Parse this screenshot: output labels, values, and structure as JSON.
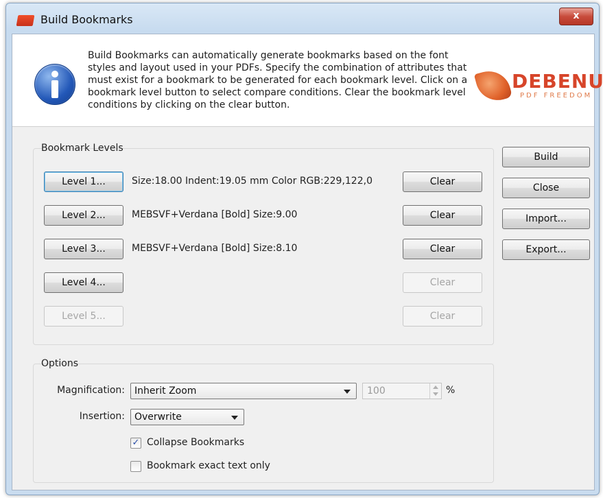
{
  "window": {
    "title": "Build Bookmarks",
    "close_glyph": "x"
  },
  "info": {
    "text": "Build Bookmarks can automatically generate bookmarks based on the font styles and layout used in your PDFs. Specify the combination of attributes that must exist for a bookmark to be generated for each bookmark level. Click on a bookmark level button to select compare conditions. Clear the bookmark level conditions by clicking on the clear button.",
    "logo_main": "DEBENU",
    "logo_sub": "PDF FREEDOM"
  },
  "bookmark_levels": {
    "label": "Bookmark Levels",
    "levels": [
      {
        "button": "Level 1...",
        "description": "Size:18.00 Indent:19.05 mm Color RGB:229,122,0",
        "clear": "Clear"
      },
      {
        "button": "Level 2...",
        "description": "MEBSVF+Verdana [Bold] Size:9.00",
        "clear": "Clear"
      },
      {
        "button": "Level 3...",
        "description": "MEBSVF+Verdana [Bold] Size:8.10",
        "clear": "Clear"
      },
      {
        "button": "Level 4...",
        "description": "",
        "clear": "Clear"
      },
      {
        "button": "Level 5...",
        "description": "",
        "clear": "Clear"
      }
    ]
  },
  "actions": {
    "build": "Build",
    "close": "Close",
    "import": "Import...",
    "export": "Export..."
  },
  "options": {
    "label": "Options",
    "magnification_label": "Magnification:",
    "magnification_value": "Inherit Zoom",
    "zoom_value": "100",
    "percent": "%",
    "insertion_label": "Insertion:",
    "insertion_value": "Overwrite",
    "collapse_label": "Collapse Bookmarks",
    "collapse_checked": true,
    "exact_label": "Bookmark exact text only",
    "exact_checked": false,
    "check_glyph": "✓"
  }
}
